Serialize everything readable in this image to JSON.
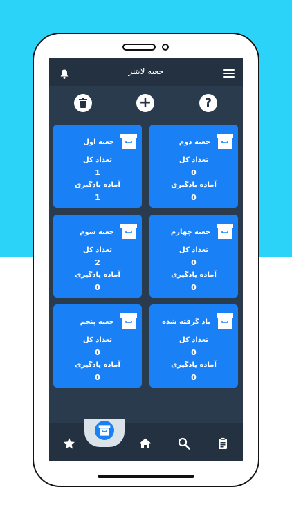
{
  "app": {
    "title": "جعبه لایتنر"
  },
  "toolbar": {
    "trash_icon": "trash-icon",
    "add_icon": "plus-icon",
    "add_symbol": "+",
    "help_icon": "question-icon",
    "help_symbol": "?"
  },
  "cards": [
    {
      "name": "جعبه اول",
      "total_label": "تعداد کل",
      "total": "1",
      "ready_label": "آماده یادگیری",
      "ready": "1"
    },
    {
      "name": "جعبه دوم",
      "total_label": "تعداد کل",
      "total": "0",
      "ready_label": "آماده یادگیری",
      "ready": "0"
    },
    {
      "name": "جعبه سوم",
      "total_label": "تعداد کل",
      "total": "2",
      "ready_label": "آماده یادگیری",
      "ready": "0"
    },
    {
      "name": "جعبه چهارم",
      "total_label": "تعداد کل",
      "total": "0",
      "ready_label": "آماده یادگیری",
      "ready": "0"
    },
    {
      "name": "جعبه پنجم",
      "total_label": "تعداد کل",
      "total": "0",
      "ready_label": "آماده یادگیری",
      "ready": "0"
    },
    {
      "name": "یاد گرفته شده",
      "total_label": "تعداد کل",
      "total": "0",
      "ready_label": "آماده یادگیری",
      "ready": "0"
    }
  ],
  "bottom_nav": [
    "star-icon",
    "box-icon",
    "home-icon",
    "search-icon",
    "notes-icon"
  ],
  "colors": {
    "background_top": "#2bd3f8",
    "screen": "#2a3b4d",
    "bar": "#233140",
    "card": "#1a80f5"
  }
}
